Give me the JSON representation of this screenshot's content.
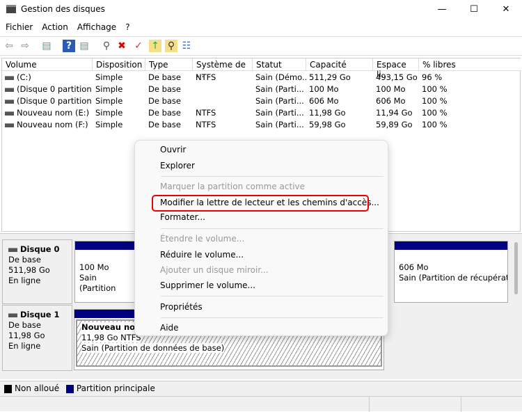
{
  "window": {
    "title": "Gestion des disques",
    "minimize": "—",
    "maximize": "☐",
    "close": "✕"
  },
  "menu": [
    "Fichier",
    "Action",
    "Affichage",
    "?"
  ],
  "columns": [
    "Volume",
    "Disposition",
    "Type",
    "Système de ...",
    "Statut",
    "Capacité",
    "Espace li...",
    "% libres"
  ],
  "rows": [
    [
      "(C:)",
      "Simple",
      "De base",
      "NTFS",
      "Sain (Démo...",
      "511,29 Go",
      "493,15 Go",
      "96 %"
    ],
    [
      "(Disque 0 partition...",
      "Simple",
      "De base",
      "",
      "Sain (Parti...",
      "100 Mo",
      "100 Mo",
      "100 %"
    ],
    [
      "(Disque 0 partition...",
      "Simple",
      "De base",
      "",
      "Sain (Parti...",
      "606 Mo",
      "606 Mo",
      "100 %"
    ],
    [
      "Nouveau nom (E:)",
      "Simple",
      "De base",
      "NTFS",
      "Sain (Parti...",
      "11,98 Go",
      "11,94 Go",
      "100 %"
    ],
    [
      "Nouveau nom (F:)",
      "Simple",
      "De base",
      "NTFS",
      "Sain (Parti...",
      "59,98 Go",
      "59,89 Go",
      "100 %"
    ]
  ],
  "disk0": {
    "name": "Disque 0",
    "type": "De base",
    "size": "511,98 Go",
    "state": "En ligne",
    "p1_size": "100 Mo",
    "p1_status": "Sain (Partition",
    "p3_size": "606 Mo",
    "p3_status": "Sain (Partition de récupératic"
  },
  "disk1": {
    "name": "Disque 1",
    "type": "De base",
    "size": "11,98 Go",
    "state": "En ligne",
    "p1_name": "Nouveau nom",
    "p1_size": "11,98 Go NTFS",
    "p1_status": "Sain (Partition de données de base)"
  },
  "legend": {
    "unallocated": "Non alloué",
    "primary": "Partition principale",
    "unallocated_color": "#000000",
    "primary_color": "#000080"
  },
  "context_menu": {
    "open": "Ouvrir",
    "explore": "Explorer",
    "mark_active": "Marquer la partition comme active",
    "change_letter": "Modifier la lettre de lecteur et les chemins d'accès...",
    "format": "Formater...",
    "extend": "Étendre le volume...",
    "shrink": "Réduire le volume...",
    "mirror": "Ajouter un disque miroir...",
    "delete": "Supprimer le volume...",
    "properties": "Propriétés",
    "help": "Aide"
  }
}
